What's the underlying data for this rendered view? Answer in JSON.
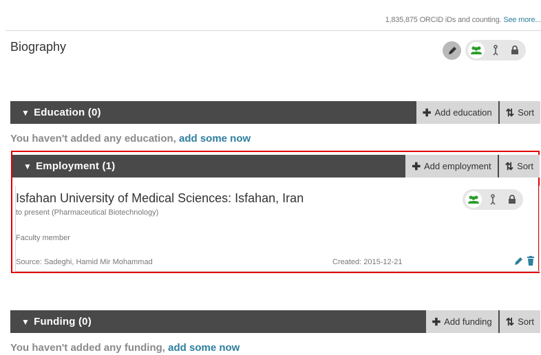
{
  "header": {
    "stat_text": "1,835,875 ORCID iDs and counting.",
    "see_more": "See more..."
  },
  "biography": {
    "title": "Biography"
  },
  "education": {
    "title": "Education (0)",
    "add_label": "Add education",
    "sort_label": "Sort",
    "empty_text": "You haven't added any education,",
    "add_link": "add some now"
  },
  "employment": {
    "title": "Employment (1)",
    "add_label": "Add employment",
    "sort_label": "Sort",
    "entry": {
      "name": "Isfahan University of Medical Sciences: Isfahan, Iran",
      "period": "to present (Pharmaceutical Biotechnology)",
      "role": "Faculty member",
      "source": "Source: Sadeghi, Hamid Mir Mohammad",
      "created": "Created: 2015-12-21"
    }
  },
  "funding": {
    "title": "Funding (0)",
    "add_label": "Add funding",
    "sort_label": "Sort",
    "empty_text": "You haven't added any funding,",
    "add_link": "add some now"
  },
  "colors": {
    "bar": "#494949",
    "button": "#d7d7d7",
    "link": "#2e7f9e",
    "public_green": "#2a9d2a",
    "highlight": "#e10000"
  }
}
